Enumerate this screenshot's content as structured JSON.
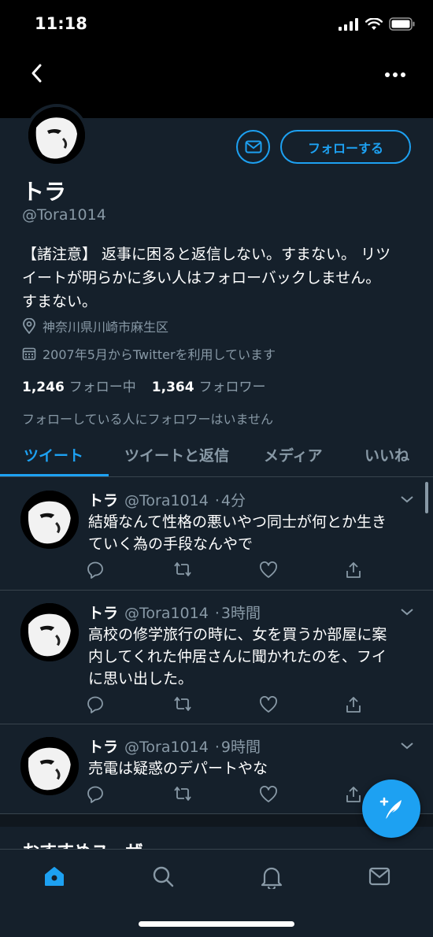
{
  "status_bar": {
    "time": "11:18"
  },
  "header": {
    "back_icon": "chevron-left-icon",
    "more_icon": "more-horizontal-icon"
  },
  "profile": {
    "name": "トラ",
    "handle": "@Tora1014",
    "follow_label": "フォローする",
    "bio_line1": "【諸注意】 返事に困ると返信しない。すまない。 リツ",
    "bio_line2": "イートが明らかに多い人はフォローバックしません。",
    "bio_line3": "すまない。",
    "location": "神奈川県川崎市麻生区",
    "joined": "2007年5月からTwitterを利用しています",
    "following_count": "1,246",
    "following_label": "フォロー中",
    "followers_count": "1,364",
    "followers_label": "フォロワー",
    "followed_by_note": "フォローしている人にフォロワーはいません"
  },
  "tabs": [
    {
      "label": "ツイート",
      "active": true
    },
    {
      "label": "ツイートと返信",
      "active": false
    },
    {
      "label": "メディア",
      "active": false
    },
    {
      "label": "いいね",
      "active": false
    }
  ],
  "tweets": [
    {
      "name": "トラ",
      "handle": "@Tora1014",
      "time": "4分",
      "line1": "結婚なんて性格の悪いやつ同士が何とか生き",
      "line2": "ていく為の手段なんやで",
      "line3": ""
    },
    {
      "name": "トラ",
      "handle": "@Tora1014",
      "time": "3時間",
      "line1": "高校の修学旅行の時に、女を買うか部屋に案",
      "line2": "内してくれた仲居さんに聞かれたのを、フイ",
      "line3": "に思い出した。"
    },
    {
      "name": "トラ",
      "handle": "@Tora1014",
      "time": "9時間",
      "line1": "売電は疑惑のデパートやな",
      "line2": "",
      "line3": ""
    }
  ],
  "partial_section_title": "おすすめユーザー",
  "colors": {
    "background": "#15202b",
    "accent": "#1da1f2",
    "muted": "#8899a6",
    "divider": "#38444d"
  },
  "bottom_nav": [
    "home-icon",
    "search-icon",
    "notifications-icon",
    "messages-icon"
  ]
}
